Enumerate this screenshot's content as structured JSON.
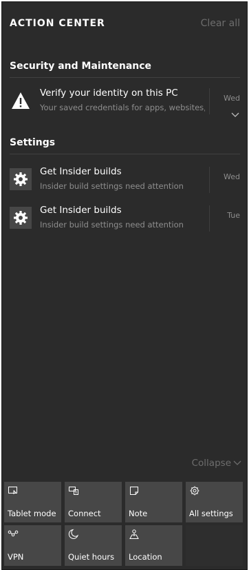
{
  "header": {
    "title": "ACTION CENTER",
    "clear_all": "Clear all"
  },
  "groups": [
    {
      "title": "Security and Maintenance",
      "notifications": [
        {
          "icon": "warning-icon",
          "title": "Verify your identity on this PC",
          "body": "Your saved credentials for apps, websites,",
          "day": "Wed",
          "expandable": true
        }
      ]
    },
    {
      "title": "Settings",
      "notifications": [
        {
          "icon": "gear-icon",
          "title": "Get Insider builds",
          "body": "Insider build settings need attention",
          "day": "Wed"
        },
        {
          "icon": "gear-icon",
          "title": "Get Insider builds",
          "body": "Insider build settings need attention",
          "day": "Tue"
        }
      ]
    }
  ],
  "collapse_label": "Collapse",
  "quick_actions": [
    {
      "label": "Tablet mode",
      "icon": "tablet-mode-icon"
    },
    {
      "label": "Connect",
      "icon": "connect-icon"
    },
    {
      "label": "Note",
      "icon": "note-icon"
    },
    {
      "label": "All settings",
      "icon": "settings-icon"
    },
    {
      "label": "VPN",
      "icon": "vpn-icon"
    },
    {
      "label": "Quiet hours",
      "icon": "moon-icon"
    },
    {
      "label": "Location",
      "icon": "location-icon"
    }
  ],
  "colors": {
    "panel_background": "#2b2b2b",
    "tile_background": "#474747",
    "muted_text": "#8e8e8e",
    "dim_text": "#6d6d6d"
  }
}
